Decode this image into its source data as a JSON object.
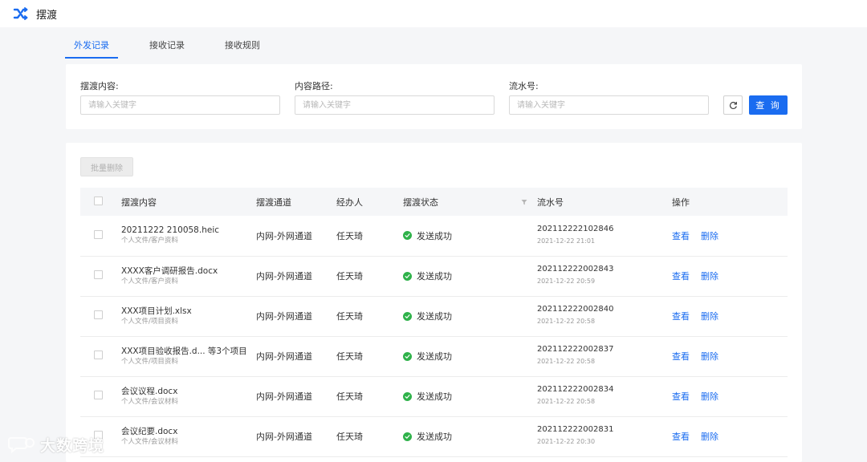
{
  "app": {
    "title": "摆渡",
    "logo_icon": "shuffle-icon"
  },
  "tabs": [
    {
      "label": "外发记录",
      "active": true
    },
    {
      "label": "接收记录",
      "active": false
    },
    {
      "label": "接收规则",
      "active": false
    }
  ],
  "filters": {
    "content": {
      "label": "摆渡内容:",
      "placeholder": "请输入关键字",
      "value": ""
    },
    "path": {
      "label": "内容路径:",
      "placeholder": "请输入关键字",
      "value": ""
    },
    "serial": {
      "label": "流水号:",
      "placeholder": "请输入关键字",
      "value": ""
    },
    "reset_icon": "refresh-icon",
    "query_label": "查 询"
  },
  "table": {
    "batch_delete_label": "批量删除",
    "columns": {
      "name": "摆渡内容",
      "channel": "摆渡通道",
      "handler": "经办人",
      "status": "摆渡状态",
      "serial": "流水号",
      "actions": "操作"
    },
    "rows": [
      {
        "name": "20211222 210058.heic",
        "path": "个人文件/客户资料",
        "channel": "内网-外网通道",
        "handler": "任天琦",
        "status": "发送成功",
        "serial": "202112222102846",
        "time": "2021-12-22 21:01",
        "view": "查看",
        "delete": "删除"
      },
      {
        "name": "XXXX客户调研报告.docx",
        "path": "个人文件/客户资料",
        "channel": "内网-外网通道",
        "handler": "任天琦",
        "status": "发送成功",
        "serial": "202112222002843",
        "time": "2021-12-22 20:59",
        "view": "查看",
        "delete": "删除"
      },
      {
        "name": "XXX项目计划.xlsx",
        "path": "个人文件/项目资料",
        "channel": "内网-外网通道",
        "handler": "任天琦",
        "status": "发送成功",
        "serial": "202112222002840",
        "time": "2021-12-22 20:58",
        "view": "查看",
        "delete": "删除"
      },
      {
        "name": "XXX项目验收报告.d... 等3个项目",
        "path": "个人文件/项目资料",
        "channel": "内网-外网通道",
        "handler": "任天琦",
        "status": "发送成功",
        "serial": "202112222002837",
        "time": "2021-12-22 20:58",
        "view": "查看",
        "delete": "删除"
      },
      {
        "name": "会议议程.docx",
        "path": "个人文件/会议材料",
        "channel": "内网-外网通道",
        "handler": "任天琦",
        "status": "发送成功",
        "serial": "202112222002834",
        "time": "2021-12-22 20:58",
        "view": "查看",
        "delete": "删除"
      },
      {
        "name": "会议纪要.docx",
        "path": "个人文件/会议材料",
        "channel": "内网-外网通道",
        "handler": "任天琦",
        "status": "发送成功",
        "serial": "202112222002831",
        "time": "2021-12-22 20:30",
        "view": "查看",
        "delete": "删除"
      }
    ]
  },
  "colors": {
    "accent": "#1a6cf0",
    "success": "#2fb24a"
  },
  "watermark": {
    "text": "大数跨境",
    "icon": "chat-bubble-icon"
  }
}
